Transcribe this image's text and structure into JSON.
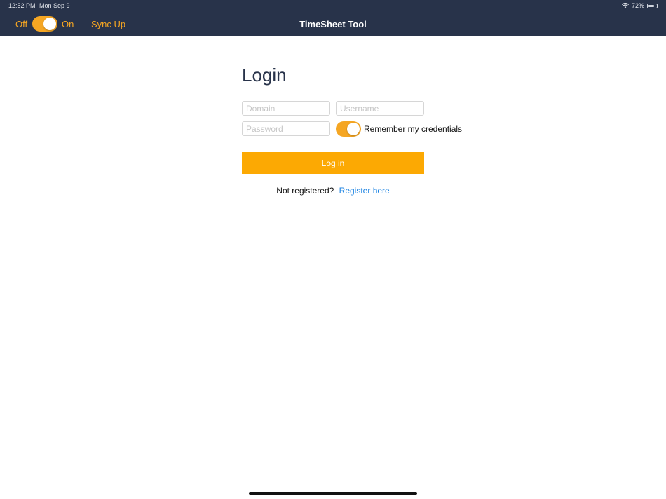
{
  "status_bar": {
    "time": "12:52 PM",
    "date": "Mon Sep 9",
    "battery": "72%",
    "battery_level": 0.72,
    "icons": [
      "wifi-icon",
      "battery-icon"
    ]
  },
  "nav": {
    "off_label": "Off",
    "on_label": "On",
    "online_toggle_on": true,
    "sync_label": "Sync Up",
    "title": "TimeSheet Tool"
  },
  "login": {
    "heading": "Login",
    "domain_placeholder": "Domain",
    "username_placeholder": "Username",
    "password_placeholder": "Password",
    "remember_label": "Remember my credentials",
    "remember_on": true,
    "button_label": "Log in",
    "register_prompt": "Not registered?",
    "register_link": "Register here"
  },
  "colors": {
    "nav_background": "#28334a",
    "accent": "#f5a623",
    "button": "#fca903",
    "link": "#1a82e2"
  }
}
